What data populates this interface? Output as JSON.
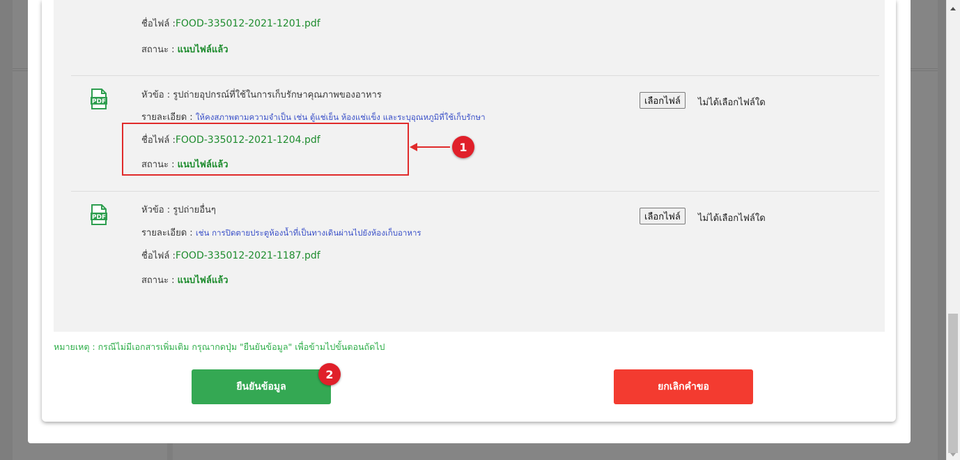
{
  "files": [
    {
      "filename_label": "ชื่อไฟล์ :",
      "filename": "FOOD-335012-2021-1201.pdf",
      "status_label": "สถานะ : ",
      "status": "แนบไฟล์แล้ว"
    },
    {
      "topic_label": "หัวข้อ : ",
      "topic": "รูปถ่ายอุปกรณ์ที่ใช้ในการเก็บรักษาคุณภาพของอาหาร",
      "detail_label": "รายละเอียด : ",
      "detail": "ให้คงสภาพตามความจำเป็น เช่น ตู้แช่เย็น ห้องแช่แข็ง และระบุอุณหภูมิที่ใช้เก็บรักษา",
      "filename_label": "ชื่อไฟล์ :",
      "filename": "FOOD-335012-2021-1204.pdf",
      "status_label": "สถานะ : ",
      "status": "แนบไฟล์แล้ว",
      "choose_button": "เลือกไฟล์",
      "no_file_text": "ไม่ได้เลือกไฟล์ใด"
    },
    {
      "topic_label": "หัวข้อ : ",
      "topic": "รูปถ่ายอื่นๆ",
      "detail_label": "รายละเอียด : ",
      "detail": "เช่น การปิดตายประตูห้องน้ำที่เป็นทางเดินผ่านไปยังห้องเก็บอาหาร",
      "filename_label": "ชื่อไฟล์ :",
      "filename": "FOOD-335012-2021-1187.pdf",
      "status_label": "สถานะ : ",
      "status": "แนบไฟล์แล้ว",
      "choose_button": "เลือกไฟล์",
      "no_file_text": "ไม่ได้เลือกไฟล์ใด"
    }
  ],
  "icons": {
    "pdf": "pdf-file-icon",
    "pdf_text": "PDF"
  },
  "note": "หมายเหตุ : กรณีไม่มีเอกสารเพิ่มเติม กรุณากดปุ่ม \"ยืนยันข้อมูล\" เพื่อข้ามไปขั้นตอนถัดไป",
  "buttons": {
    "confirm": "ยืนยันข้อมูล",
    "cancel": "ยกเลิกคำขอ"
  },
  "annotations": {
    "badge1": "1",
    "badge2": "2"
  },
  "colors": {
    "confirm": "#34a853",
    "cancel": "#f33b30",
    "annotation": "#e0202a",
    "green_text": "#1e8c2e",
    "blue_text": "#3a50c8",
    "note_text": "#2fae4a"
  }
}
